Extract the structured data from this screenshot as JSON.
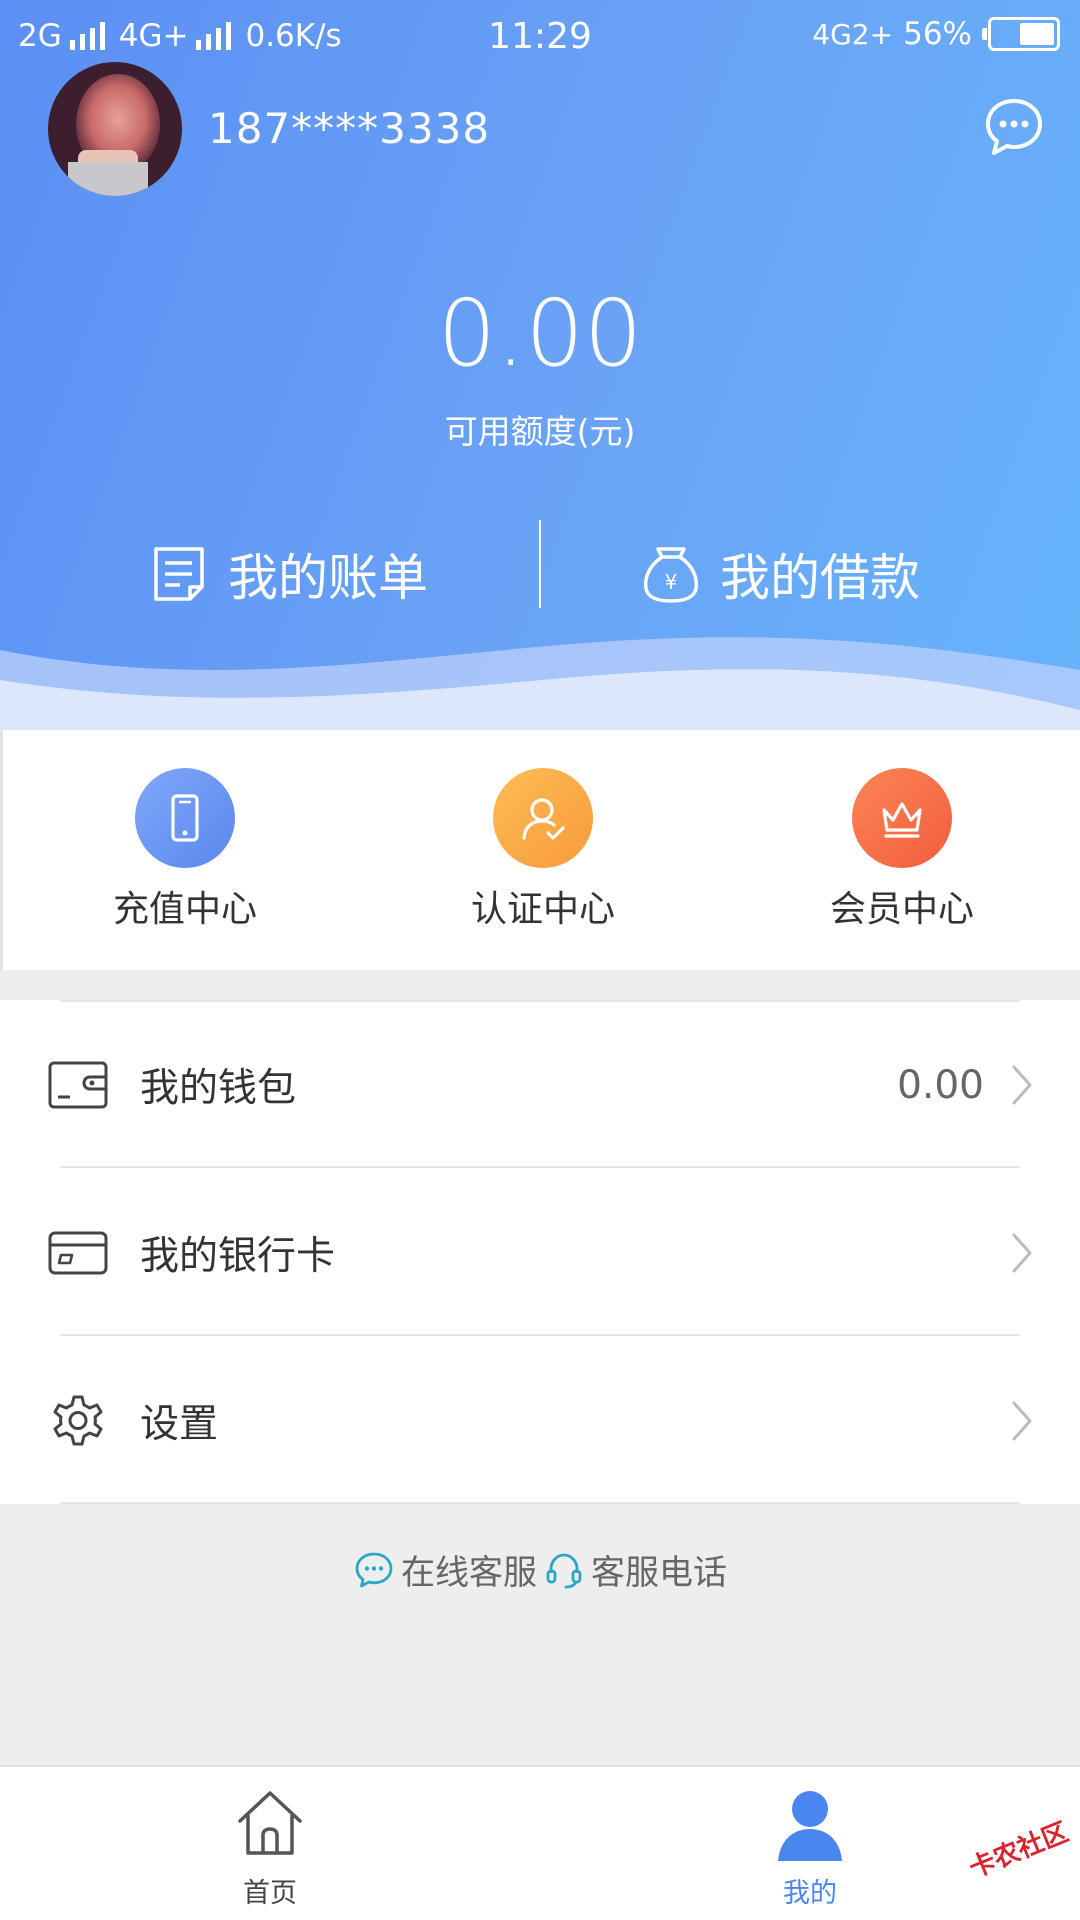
{
  "status_bar": {
    "network_left": "2G",
    "network_mid": "4G+",
    "speed": "0.6K/s",
    "time": "11:29",
    "network_right": "4G2+",
    "battery": "56%",
    "battery_level": 0.56
  },
  "profile": {
    "phone": "187****3338",
    "message_icon": "chat-bubble-icon"
  },
  "balance": {
    "amount": "0.00",
    "label": "可用额度(元)"
  },
  "header_entries": [
    {
      "label": "我的账单",
      "icon": "bill-icon"
    },
    {
      "label": "我的借款",
      "icon": "money-bag-icon"
    }
  ],
  "quick_actions": [
    {
      "label": "充值中心",
      "icon": "phone-icon",
      "color": "#5b87ef"
    },
    {
      "label": "认证中心",
      "icon": "user-check-icon",
      "color": "#f89a3c"
    },
    {
      "label": "会员中心",
      "icon": "crown-icon",
      "color": "#f35d3d"
    }
  ],
  "menu": [
    {
      "label": "我的钱包",
      "value": "0.00",
      "icon": "wallet-icon"
    },
    {
      "label": "我的银行卡",
      "value": "",
      "icon": "bank-card-icon"
    },
    {
      "label": "设置",
      "value": "",
      "icon": "gear-icon"
    }
  ],
  "support": {
    "online": "在线客服",
    "phone": "客服电话",
    "accent": "#2aa6c6"
  },
  "tabs": [
    {
      "label": "首页",
      "icon": "home-icon"
    },
    {
      "label": "我的",
      "icon": "user-icon",
      "active": true
    }
  ],
  "watermark": "卡农社区"
}
